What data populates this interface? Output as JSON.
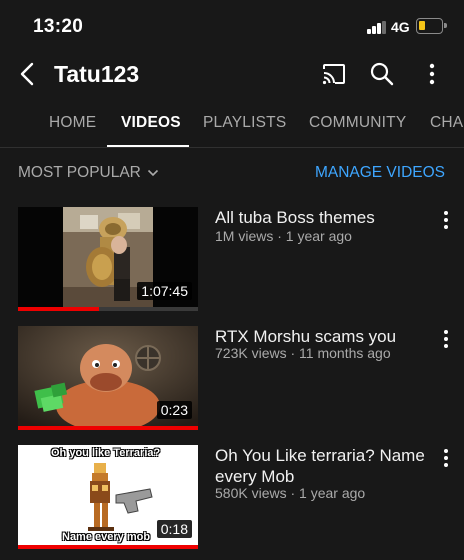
{
  "status": {
    "time": "13:20",
    "network": "4G"
  },
  "appbar": {
    "title": "Tatu123",
    "icons": [
      "back-arrow-icon",
      "cast-icon",
      "search-icon",
      "more-vert-icon"
    ]
  },
  "tabs": [
    {
      "label": "HOME",
      "active": false
    },
    {
      "label": "VIDEOS",
      "active": true
    },
    {
      "label": "PLAYLISTS",
      "active": false
    },
    {
      "label": "COMMUNITY",
      "active": false
    },
    {
      "label": "CHA",
      "active": false
    }
  ],
  "sort": {
    "label": "MOST POPULAR",
    "manage_label": "MANAGE VIDEOS"
  },
  "videos": [
    {
      "title": "All tuba Boss themes",
      "meta": "1M views · 1 year ago",
      "duration": "1:07:45",
      "watched_fraction": 0.45
    },
    {
      "title": "RTX Morshu scams you",
      "meta": "723K views · 11 months ago",
      "duration": "0:23",
      "watched_fraction": 1.0
    },
    {
      "title": "Oh You Like terraria? Name every Mob",
      "meta": "580K views · 1 year ago",
      "duration": "0:18",
      "watched_fraction": 1.0,
      "thumb_top_text": "Oh you like Terraria?",
      "thumb_bottom_text": "Name every mob"
    }
  ],
  "colors": {
    "background": "#181818",
    "accent": "#3ea6ff",
    "progress": "#e00000",
    "battery": "#f5c518"
  }
}
